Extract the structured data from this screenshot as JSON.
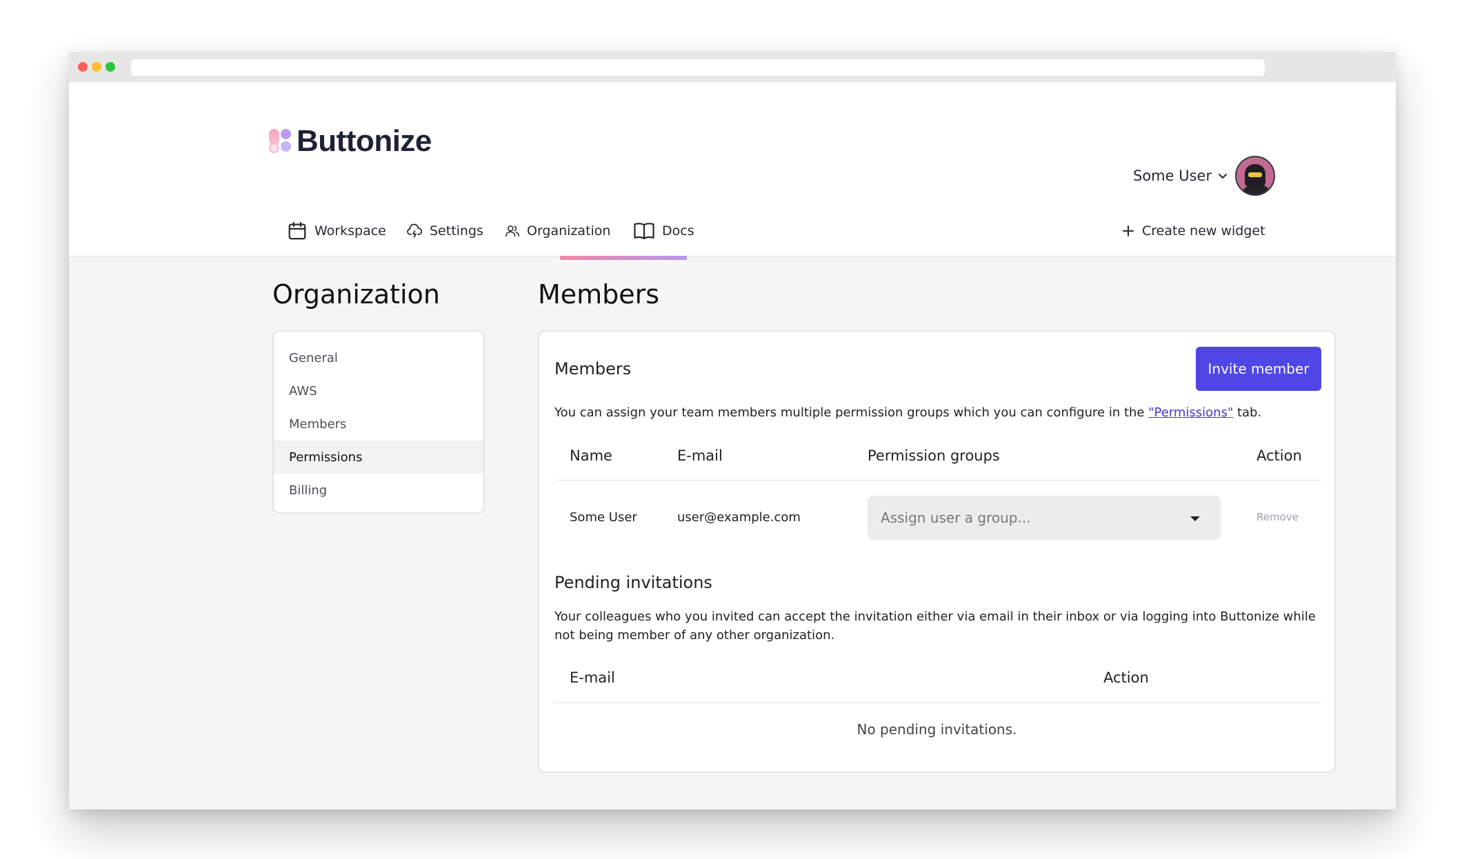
{
  "brand": {
    "name": "Buttonize"
  },
  "user": {
    "name": "Some User"
  },
  "nav": {
    "items": [
      {
        "label": "Workspace",
        "icon": "calendar-icon"
      },
      {
        "label": "Settings",
        "icon": "cloud-lightning-icon"
      },
      {
        "label": "Organization",
        "icon": "users-icon"
      },
      {
        "label": "Docs",
        "icon": "book-icon"
      }
    ],
    "active": "Organization",
    "create_label": "Create new widget"
  },
  "sidebar": {
    "title": "Organization",
    "items": [
      {
        "label": "General"
      },
      {
        "label": "AWS"
      },
      {
        "label": "Members"
      },
      {
        "label": "Permissions"
      },
      {
        "label": "Billing"
      }
    ],
    "active": "Permissions"
  },
  "main": {
    "title": "Members",
    "members": {
      "title": "Members",
      "invite_label": "Invite member",
      "desc_before": "You can assign your team members multiple permission groups which you can configure in the ",
      "desc_link": "\"Permissions\"",
      "desc_after": " tab.",
      "headers": {
        "name": "Name",
        "email": "E-mail",
        "groups": "Permission groups",
        "action": "Action"
      },
      "rows": [
        {
          "name": "Some User",
          "email": "user@example.com",
          "group_placeholder": "Assign user a group...",
          "action": "Remove"
        }
      ]
    },
    "pending": {
      "title": "Pending invitations",
      "desc": "Your colleagues who you invited can accept the invitation either via email in their inbox or via logging into Buttonize while not being member of any other organization.",
      "headers": {
        "email": "E-mail",
        "action": "Action"
      },
      "empty": "No pending invitations."
    }
  },
  "colors": {
    "accent": "#4f46e5",
    "link": "#4338ca",
    "active_tab_gradient": [
      "#f08aa6",
      "#b894ef"
    ]
  }
}
